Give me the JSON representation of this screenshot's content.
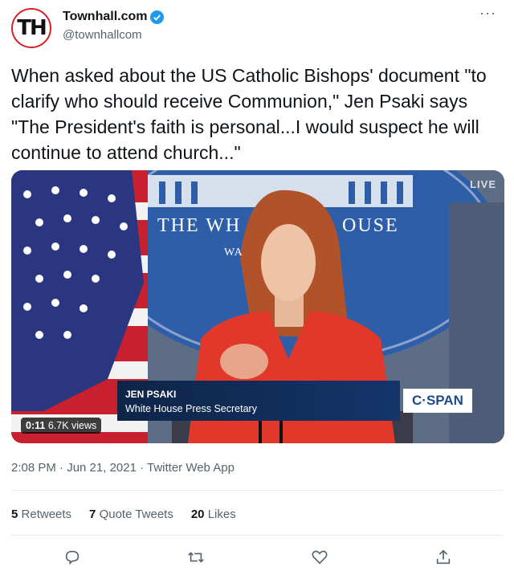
{
  "author": {
    "avatar_text": "TH",
    "display_name": "Townhall.com",
    "handle": "@townhallcom",
    "verified": true
  },
  "menu": {
    "more_label": "···"
  },
  "tweet": {
    "text": "When asked about the US Catholic Bishops' document \"to clarify who should receive Communion,\" Jen Psaki says \"The President's faith is personal...I would suspect he will continue to attend church...\""
  },
  "video": {
    "live_badge": "LIVE",
    "backdrop_text_1": "THE WH",
    "backdrop_text_2": "OUSE",
    "backdrop_text_3": "WA",
    "lower_third_name": "JEN PSAKI",
    "lower_third_title": "White House Press Secretary",
    "network_logo": "C·SPAN",
    "time_elapsed": "0:11",
    "views": "6.7K views"
  },
  "meta": {
    "line": "2:08 PM · Jun 21, 2021 · Twitter Web App"
  },
  "stats": {
    "retweets_count": "5",
    "retweets_label": "Retweets",
    "quotes_count": "7",
    "quotes_label": "Quote Tweets",
    "likes_count": "20",
    "likes_label": "Likes"
  },
  "colors": {
    "accent": "#1d9bf0",
    "brand_red": "#d92027",
    "muted": "#536471"
  },
  "icons": [
    "verified-badge-icon",
    "reply-icon",
    "retweet-icon",
    "like-icon",
    "share-icon"
  ]
}
